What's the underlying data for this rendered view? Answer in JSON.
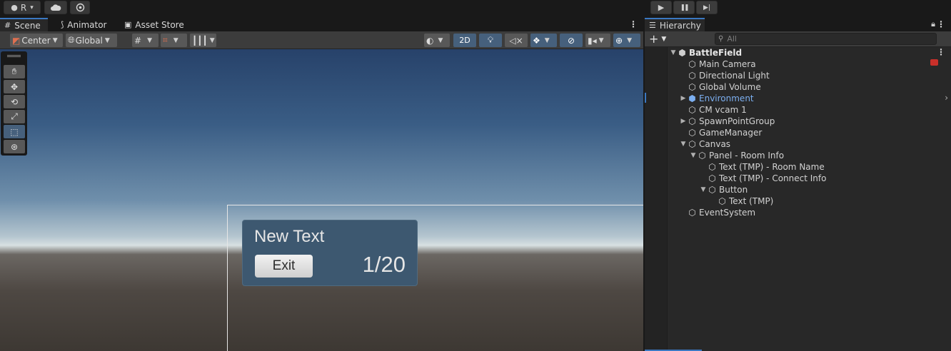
{
  "toolbar": {
    "account_label": "R",
    "account_caret": "▾",
    "cloud_icon": "cloud-icon",
    "settings_icon": "gear-icon",
    "play_icon": "▶",
    "pause_icon": "❚❚",
    "step_icon": "▶|"
  },
  "scene_tabs": [
    {
      "label": "Scene",
      "icon": "#"
    },
    {
      "label": "Animator",
      "icon": "⚲"
    },
    {
      "label": "Asset Store",
      "icon": "🛍"
    }
  ],
  "scene_toolbar": {
    "pivot": "Center",
    "space": "Global",
    "twod": "2D"
  },
  "game_ui": {
    "title": "New Text",
    "exit_label": "Exit",
    "count": "1/20"
  },
  "hierarchy": {
    "tab_label": "Hierarchy",
    "add_label": "+",
    "search_placeholder": "All",
    "items": [
      {
        "label": "BattleField",
        "depth": 0,
        "arrow": "▼",
        "icon": "⬢"
      },
      {
        "label": "Main Camera",
        "depth": 1,
        "arrow": "",
        "icon": "⬡"
      },
      {
        "label": "Directional Light",
        "depth": 1,
        "arrow": "",
        "icon": "⬡"
      },
      {
        "label": "Global Volume",
        "depth": 1,
        "arrow": "",
        "icon": "⬡"
      },
      {
        "label": "Environment",
        "depth": 1,
        "arrow": "▶",
        "icon": "⬢"
      },
      {
        "label": "CM vcam 1",
        "depth": 1,
        "arrow": "",
        "icon": "⬡"
      },
      {
        "label": "SpawnPointGroup",
        "depth": 1,
        "arrow": "▶",
        "icon": "⬡"
      },
      {
        "label": "GameManager",
        "depth": 1,
        "arrow": "",
        "icon": "⬡"
      },
      {
        "label": "Canvas",
        "depth": 1,
        "arrow": "▼",
        "icon": "⬡"
      },
      {
        "label": "Panel - Room Info",
        "depth": 2,
        "arrow": "▼",
        "icon": "⬡"
      },
      {
        "label": "Text (TMP) - Room Name",
        "depth": 3,
        "arrow": "",
        "icon": "⬡"
      },
      {
        "label": "Text (TMP) - Connect Info",
        "depth": 3,
        "arrow": "",
        "icon": "⬡"
      },
      {
        "label": "Button",
        "depth": 3,
        "arrow": "▼",
        "icon": "⬡"
      },
      {
        "label": "Text (TMP)",
        "depth": 4,
        "arrow": "",
        "icon": "⬡"
      },
      {
        "label": "EventSystem",
        "depth": 1,
        "arrow": "",
        "icon": "⬡"
      }
    ]
  },
  "colors": {
    "accent": "#3a78c2",
    "selected_tool": "#46607c",
    "prefab_blue": "#7caff0"
  }
}
